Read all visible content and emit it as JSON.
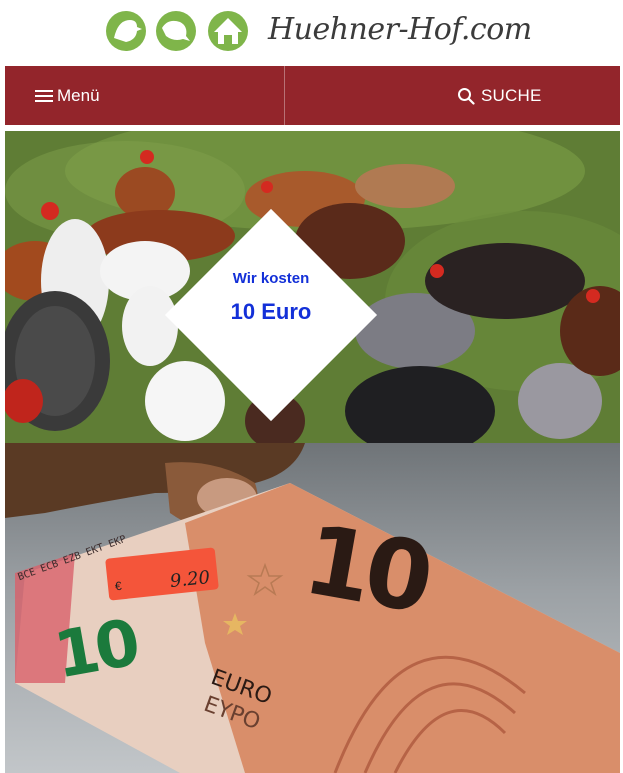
{
  "header": {
    "brand": "Huehner-Hof.com",
    "logo_icons": [
      "chicken-icon",
      "chicken-eating-icon",
      "henhouse-icon"
    ]
  },
  "nav": {
    "menu_label": "Menü",
    "search_label": "SUCHE",
    "bg_color": "#93252b"
  },
  "hero": {
    "price_line1": "Wir kosten",
    "price_line2": "10 Euro",
    "price_color": "#1330d8"
  },
  "banknote": {
    "price_tag": "9.20",
    "currency_symbol": "€",
    "big_denomination": "10",
    "small_denomination": "10",
    "currency_word_1": "EURO",
    "currency_word_2": "EYPO",
    "serial_strip": "BCE ECB EZB EKT EKP"
  }
}
